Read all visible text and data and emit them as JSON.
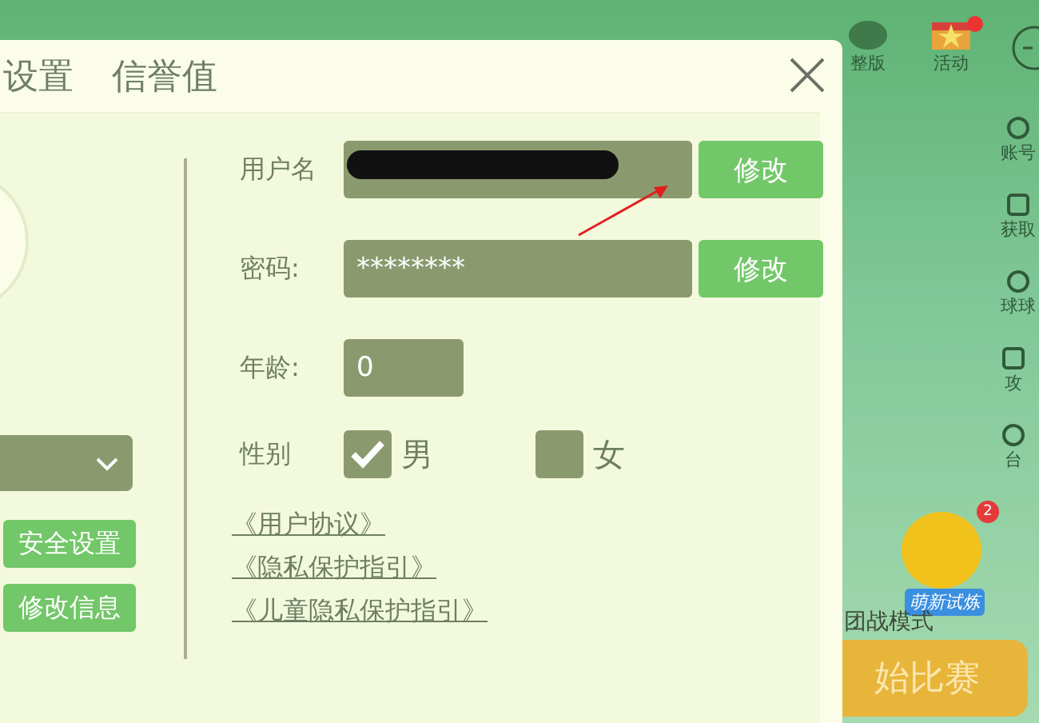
{
  "game": {
    "top_icons": [
      {
        "label": "整版",
        "kind": "blob"
      },
      {
        "label": "活动",
        "kind": "gift"
      }
    ],
    "side_icons": [
      {
        "label": "账号"
      },
      {
        "label": "获取"
      },
      {
        "label": "球球"
      },
      {
        "label": "攻"
      },
      {
        "label": "台"
      }
    ],
    "character_tag": "萌新试炼",
    "character_badge": "2",
    "mode_label": "团战模式",
    "start_button": "始比赛"
  },
  "dialog": {
    "tabs": [
      "设置",
      "信誉值"
    ],
    "left": {
      "buttons": [
        "安全设置",
        "修改信息"
      ]
    },
    "form": {
      "username": {
        "label": "用户名",
        "redacted": true,
        "button": "修改"
      },
      "password": {
        "label": "密码:",
        "value": "********",
        "button": "修改"
      },
      "age": {
        "label": "年龄:",
        "value": "0"
      },
      "gender": {
        "label": "性别",
        "options": [
          {
            "label": "男",
            "selected": true
          },
          {
            "label": "女",
            "selected": false
          }
        ]
      },
      "links": [
        "《用户协议》",
        "《隐私保护指引》",
        "《儿童隐私保护指引》"
      ]
    }
  }
}
